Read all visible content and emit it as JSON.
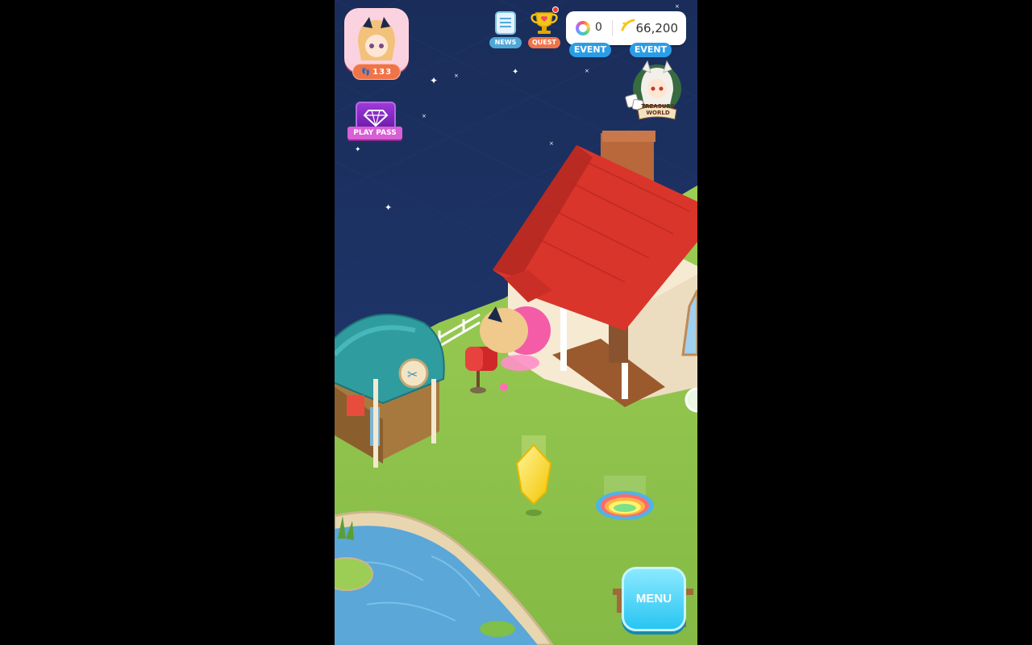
{
  "player": {
    "level": "133"
  },
  "hud": {
    "news_label": "NEWS",
    "quest_label": "QUEST",
    "quest_has_notification": true,
    "playpass_label": "PLAY PASS",
    "menu_label": "MENU"
  },
  "currency": {
    "coins": "0",
    "gold": "66,200",
    "coins_event_label": "EVENT",
    "gold_event_label": "EVENT"
  },
  "treasure": {
    "line1": "TREASURE",
    "line2": "WORLD"
  },
  "colors": {
    "sky": "#1d2f5e",
    "grass": "#8fc24c",
    "roof": "#d9352b",
    "water": "#5aa7d8",
    "menu": "#28c5f2",
    "event": "#2b9de6"
  }
}
